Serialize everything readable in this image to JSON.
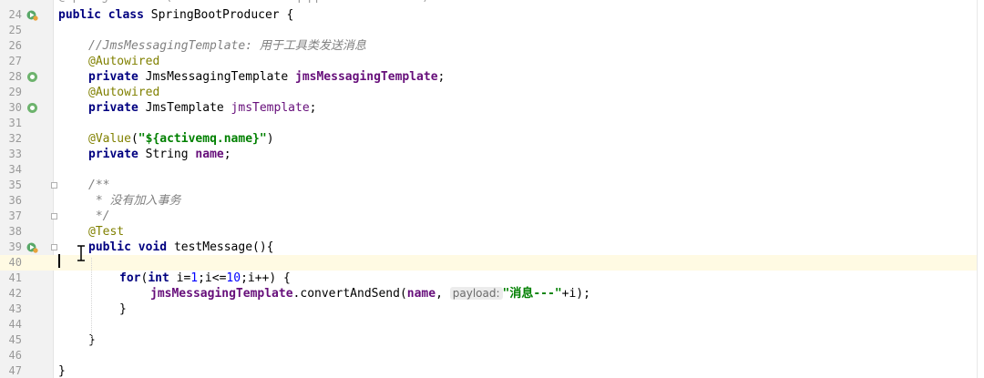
{
  "editor": {
    "lines": [
      {
        "n": "24",
        "text": "public class SpringBootProducer {"
      },
      {
        "n": "25",
        "text": ""
      },
      {
        "n": "26",
        "text": "//JmsMessagingTemplate: 用于工具类发送消息"
      },
      {
        "n": "27",
        "text": "@Autowired"
      },
      {
        "n": "28",
        "kw": "private",
        "type": "JmsMessagingTemplate",
        "name": "jmsMessagingTemplate",
        "end": ";"
      },
      {
        "n": "29",
        "text": "@Autowired"
      },
      {
        "n": "30",
        "kw": "private",
        "type": "JmsTemplate",
        "name": "jmsTemplate",
        "end": ";"
      },
      {
        "n": "31",
        "text": ""
      },
      {
        "n": "32",
        "anno": "@Value",
        "open": "(",
        "str": "\"${activemq.name}\"",
        "close": ")"
      },
      {
        "n": "33",
        "kw": "private",
        "type": "String",
        "name": "name",
        "end": ";"
      },
      {
        "n": "34",
        "text": ""
      },
      {
        "n": "35",
        "text": "/**"
      },
      {
        "n": "36",
        "text": " * 没有加入事务"
      },
      {
        "n": "37",
        "text": " */"
      },
      {
        "n": "38",
        "text": "@Test"
      },
      {
        "n": "39",
        "kw1": "public",
        "kw2": "void",
        "rest": "testMessage(){"
      },
      {
        "n": "40",
        "text": ""
      },
      {
        "n": "41",
        "kw1": "for",
        "p1": "(",
        "kw2": "int",
        "p2": " i=",
        "num1": "1",
        "p3": ";i<=",
        "num2": "10",
        "p4": ";i++) {"
      },
      {
        "n": "42",
        "field": "jmsMessagingTemplate",
        "mid": ".convertAndSend(",
        "arg": "name",
        "comma": ", ",
        "hint": "payload:",
        "str": "\"消息---\"",
        "tail": "+i);"
      },
      {
        "n": "43",
        "text": "}"
      },
      {
        "n": "44",
        "text": ""
      },
      {
        "n": "45",
        "text": "}"
      },
      {
        "n": "46",
        "text": ""
      },
      {
        "n": "47",
        "text": "}"
      }
    ]
  },
  "gutter_icons": {
    "run_class": "run-icon",
    "bean_autowired": "spring-bean-icon",
    "run_method": "run-icon"
  }
}
